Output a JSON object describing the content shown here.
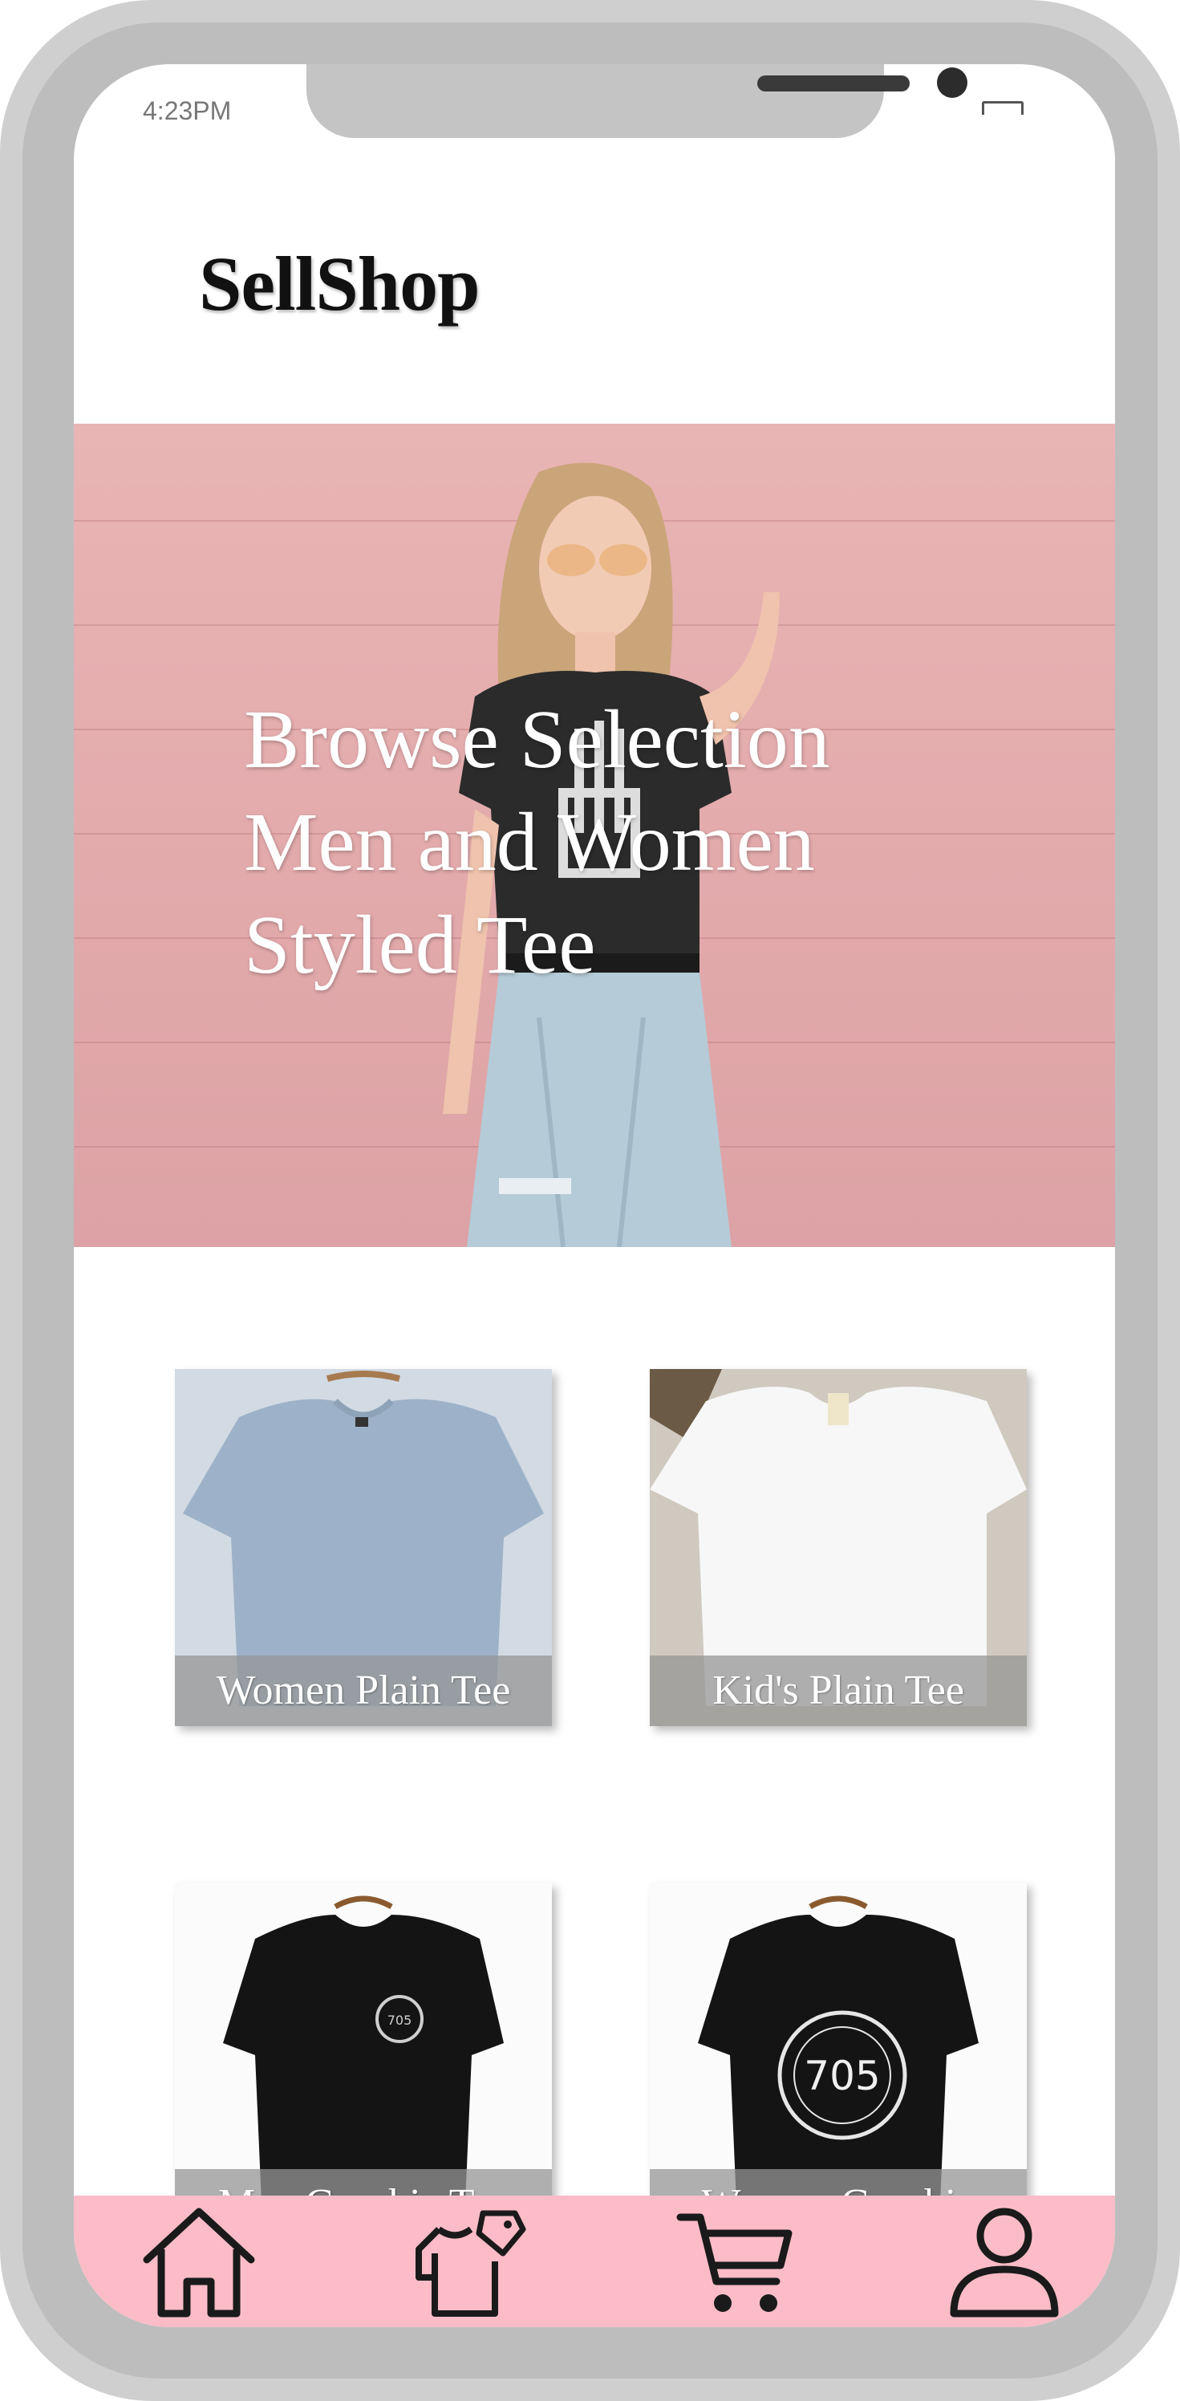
{
  "status_bar": {
    "time": "4:23PM"
  },
  "header": {
    "logo": "SellShop"
  },
  "hero": {
    "lines": [
      "Browse Selection",
      "Men and Women",
      "Styled Tee"
    ]
  },
  "products": [
    {
      "label": "Women Plain Tee",
      "image": "grey-tshirt-on-hanger"
    },
    {
      "label": "Kid's Plain Tee",
      "image": "white-tshirt-flat-lay"
    },
    {
      "label": "Men Graphic Tee",
      "image": "black-tshirt-small-logo"
    },
    {
      "label": "Women Graphic",
      "image": "black-tshirt-705-print"
    }
  ],
  "graphic_text": {
    "badge": "705",
    "small_badge": "705"
  },
  "bottom_nav": [
    {
      "icon": "home-icon"
    },
    {
      "icon": "clothing-tag-icon"
    },
    {
      "icon": "cart-icon"
    },
    {
      "icon": "user-icon"
    }
  ],
  "colors": {
    "nav_background": "#fbbcc7",
    "hero_background": "#e2a9ab",
    "label_overlay": "#969696"
  }
}
